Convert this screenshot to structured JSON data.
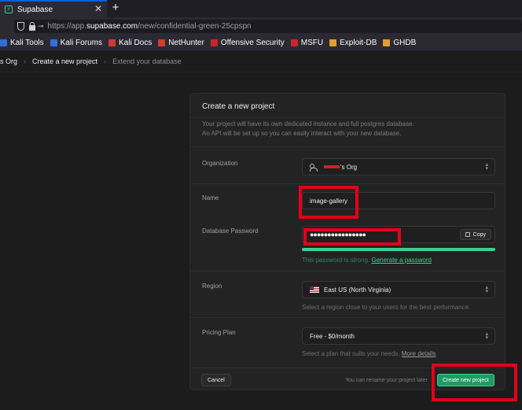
{
  "browser": {
    "tab_title": "Supabase",
    "tab_close": "✕",
    "newtab": "+",
    "url_prefix": "https://app.",
    "url_domain": "supabase.com",
    "url_path": "/new/confidential-green-25cpspn"
  },
  "bookmarks": [
    {
      "label": "Kali Tools",
      "color": "#2f6fd6"
    },
    {
      "label": "Kali Forums",
      "color": "#2f6fd6"
    },
    {
      "label": "Kali Docs",
      "color": "#d23b2f"
    },
    {
      "label": "NetHunter",
      "color": "#d23b2f"
    },
    {
      "label": "Offensive Security",
      "color": "#c62828"
    },
    {
      "label": "MSFU",
      "color": "#c62828"
    },
    {
      "label": "Exploit-DB",
      "color": "#e0a030"
    },
    {
      "label": "GHDB",
      "color": "#e0a030"
    }
  ],
  "breadcrumb": {
    "org": "s Org",
    "current": "Create a new project",
    "next": "Extend your database",
    "sep": "›"
  },
  "form": {
    "title": "Create a new project",
    "desc_line1": "Your project will have its own dedicated instance and full postgres database.",
    "desc_line2": "An API will be set up so you can easily interact with your new database.",
    "organization_label": "Organization",
    "organization_value": "'s Org",
    "name_label": "Name",
    "name_value": "image-gallery",
    "password_label": "Database Password",
    "password_value": "●●●●●●●●●●●●●●●●",
    "copy_label": "Copy",
    "password_strength": 1.0,
    "strength_text": "This password is strong.",
    "generate_link": "Generate a password",
    "region_label": "Region",
    "region_value": "East US (North Virginia)",
    "region_help": "Select a region close to your users for the best performance.",
    "plan_label": "Pricing Plan",
    "plan_value": "Free - $0/month",
    "plan_help": "Select a plan that suits your needs.",
    "plan_help_link": "More details",
    "cancel_label": "Cancel",
    "footer_note": "You can rename your project later",
    "create_label": "Create new project"
  },
  "colors": {
    "accent": "#3ecf8e",
    "annotation": "#e3001b"
  }
}
